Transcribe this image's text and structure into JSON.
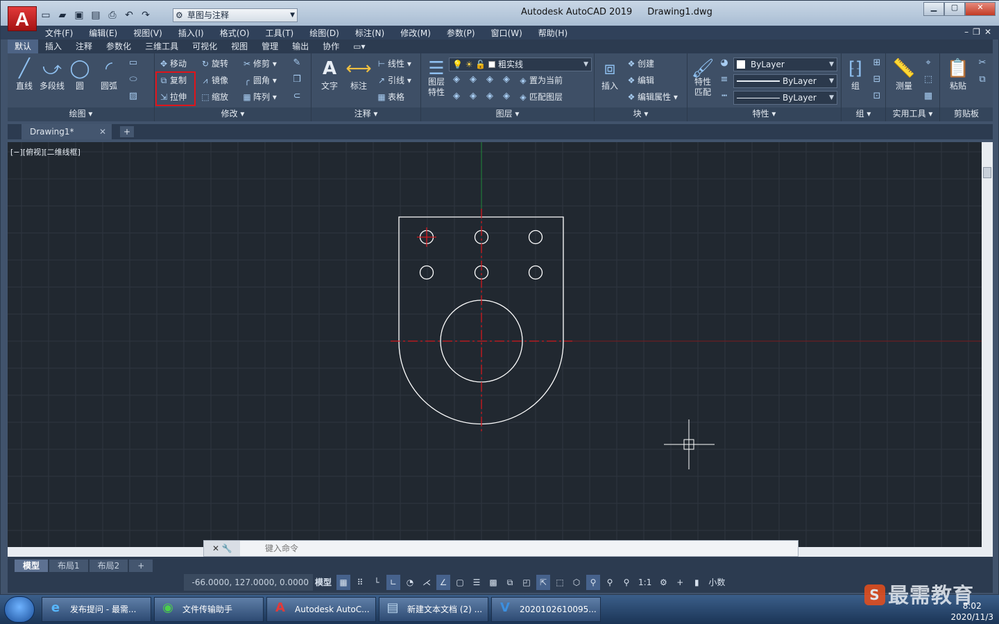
{
  "title_bar": {
    "app_name": "Autodesk AutoCAD 2019",
    "document": "Drawing1.dwg",
    "workspace": "草图与注释",
    "logo": "A"
  },
  "menu": [
    "文件(F)",
    "编辑(E)",
    "视图(V)",
    "插入(I)",
    "格式(O)",
    "工具(T)",
    "绘图(D)",
    "标注(N)",
    "修改(M)",
    "参数(P)",
    "窗口(W)",
    "帮助(H)"
  ],
  "ribbon_tabs": [
    "默认",
    "插入",
    "注释",
    "参数化",
    "三维工具",
    "可视化",
    "视图",
    "管理",
    "输出",
    "协作"
  ],
  "panels": {
    "draw": {
      "title": "绘图",
      "tools": [
        "直线",
        "多段线",
        "圆",
        "圆弧"
      ]
    },
    "modify": {
      "title": "修改",
      "tools": [
        "移动",
        "旋转",
        "修剪",
        "复制",
        "镜像",
        "圆角",
        "拉伸",
        "缩放",
        "阵列"
      ]
    },
    "annotation": {
      "title": "注释",
      "tools": [
        "文字",
        "标注",
        "线性",
        "引线",
        "表格"
      ]
    },
    "layers": {
      "title": "图层",
      "big_tool": "图层\n特性",
      "layer_name": "粗实线",
      "tools": [
        "置为当前",
        "匹配图层"
      ]
    },
    "block": {
      "title": "块",
      "tools": [
        "插入",
        "创建",
        "编辑",
        "编辑属性"
      ]
    },
    "properties": {
      "title": "特性",
      "big_tool": "特性\n匹配",
      "color": "ByLayer",
      "linetype": "ByLayer",
      "lineweight": "ByLayer"
    },
    "groups": {
      "title": "组",
      "tools": [
        "组"
      ]
    },
    "utilities": {
      "title": "实用工具",
      "tools": [
        "测量"
      ]
    },
    "clipboard": {
      "title": "剪贴板",
      "tools": [
        "粘贴"
      ]
    }
  },
  "file_tab": "Drawing1*",
  "viewport_label": "[−][俯视][二维线框]",
  "command_placeholder": "键入命令",
  "layout_tabs": [
    "模型",
    "布局1",
    "布局2"
  ],
  "status": {
    "coords": "-66.0000, 127.0000, 0.0000",
    "model": "模型",
    "scale": "1:1",
    "units": "小数"
  },
  "taskbar": {
    "items": [
      "发布提问 - 最需...",
      "文件传输助手",
      "Autodesk AutoC...",
      "新建文本文档 (2) ...",
      "2020102610095..."
    ],
    "clock_time": "8:02",
    "clock_date": "2020/11/3"
  },
  "watermark": "最需教育",
  "colors": {
    "canvas": "#212830",
    "grid": "#2e3640",
    "geometry": "#ffffff",
    "centerline": "#d4181e",
    "highlight": "#e0141a"
  }
}
